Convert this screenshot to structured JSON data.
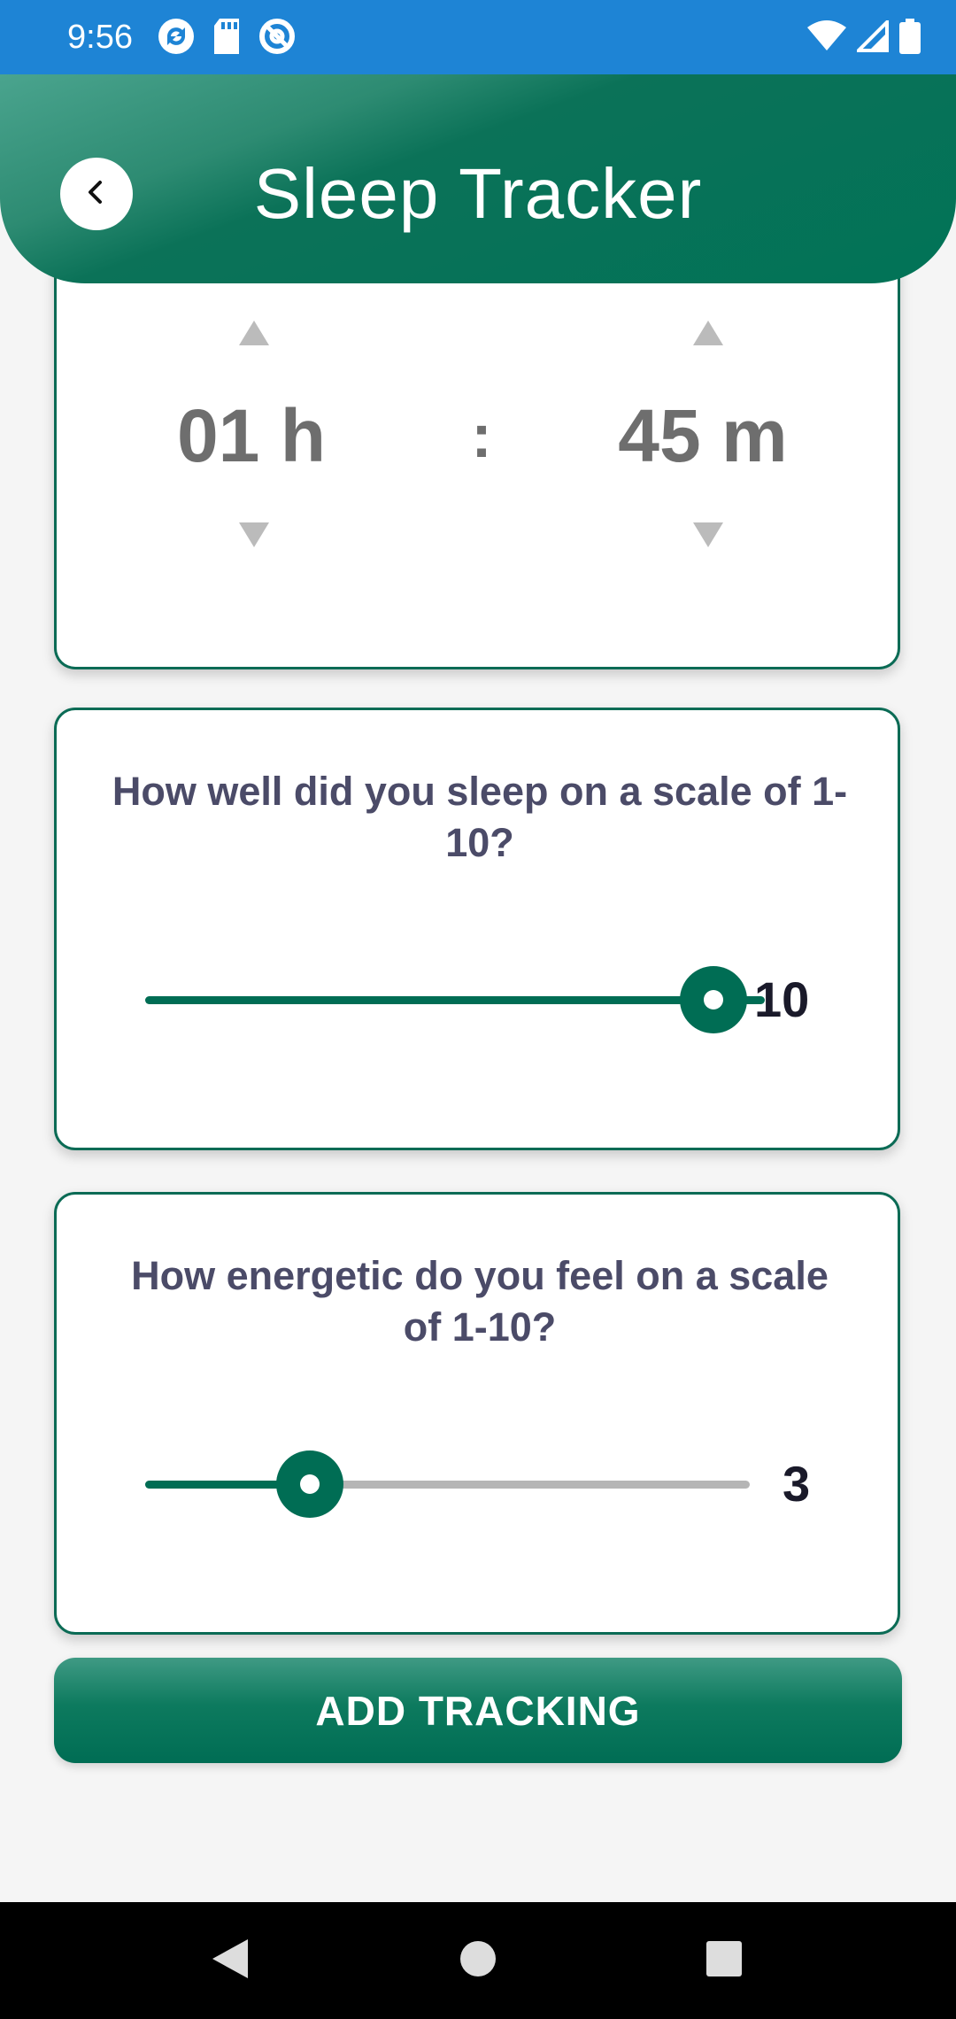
{
  "status_bar": {
    "time": "9:56",
    "left_icons": [
      "sync-icon",
      "sd-card-icon",
      "at-sign-icon"
    ],
    "right_icons": [
      "wifi-icon",
      "cellular-signal-icon",
      "battery-icon"
    ]
  },
  "header": {
    "title": "Sleep Tracker",
    "back_icon": "chevron-left-icon"
  },
  "duration_picker": {
    "hours": "01 h",
    "separator": ":",
    "minutes": "45 m"
  },
  "sleep_quality": {
    "question": "How well did you sleep on a scale of 1-10?",
    "value": "10",
    "min": 1,
    "max": 10
  },
  "energy_level": {
    "question": "How energetic do you feel on a scale of 1-10?",
    "value": "3",
    "min": 1,
    "max": 10
  },
  "add_button": {
    "label": "ADD TRACKING"
  },
  "colors": {
    "status_bar": "#1e84d5",
    "primary_green": "#006d54",
    "track_inactive": "#b5b5b5"
  },
  "nav_bar": {
    "icons": [
      "back-triangle-icon",
      "home-circle-icon",
      "recents-square-icon"
    ]
  }
}
